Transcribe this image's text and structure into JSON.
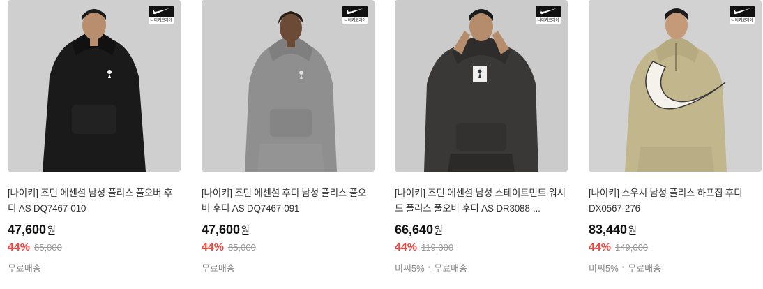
{
  "products": [
    {
      "title": "[나이키] 조던 에센셜 남성 플리스 풀오버 후디 AS DQ7467-010",
      "price": "47,600",
      "currency": "원",
      "discount_rate": "44%",
      "original_price": "85,000",
      "shipping": [
        "무료배송"
      ],
      "brand_badge": "나이키코리아",
      "hoodie_color": "#1a1a1a",
      "icon": "jumpman-logo"
    },
    {
      "title": "[나이키] 조던 에센셜 후디 남성 플리스 풀오버 후디 AS DQ7467-091",
      "price": "47,600",
      "currency": "원",
      "discount_rate": "44%",
      "original_price": "85,000",
      "shipping": [
        "무료배송"
      ],
      "brand_badge": "나이키코리아",
      "hoodie_color": "#8f8f8f",
      "icon": "jumpman-logo"
    },
    {
      "title": "[나이키] 조던 에센셜 남성 스테이트먼트 워시드 플리스 풀오버 후디 AS DR3088-...",
      "price": "66,640",
      "currency": "원",
      "discount_rate": "44%",
      "original_price": "119,000",
      "shipping": [
        "비씨5%",
        "무료배송"
      ],
      "brand_badge": "나이키코리아",
      "hoodie_color": "#3a3836",
      "icon": "jumpman-patch"
    },
    {
      "title": "[나이키] 스우시 남성 플리스 하프집 후디 DX0567-276",
      "price": "83,440",
      "currency": "원",
      "discount_rate": "44%",
      "original_price": "149,000",
      "shipping": [
        "비씨5%",
        "무료배송"
      ],
      "brand_badge": "나이키코리아",
      "hoodie_color": "#c2b68c",
      "icon": "swoosh-graphic"
    }
  ],
  "colors": {
    "discount": "#f5433c",
    "muted": "#888888"
  }
}
